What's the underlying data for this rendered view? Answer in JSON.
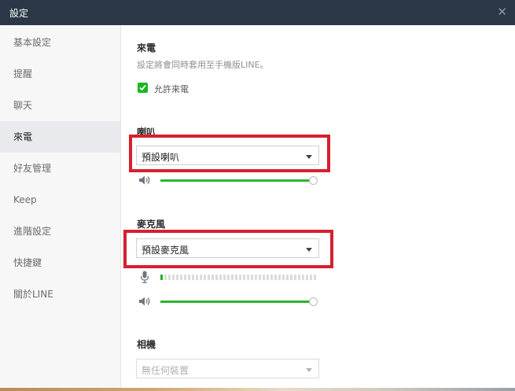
{
  "window": {
    "title": "設定"
  },
  "sidebar": {
    "items": [
      {
        "label": "基本設定"
      },
      {
        "label": "提醒"
      },
      {
        "label": "聊天"
      },
      {
        "label": "來電"
      },
      {
        "label": "好友管理"
      },
      {
        "label": "Keep"
      },
      {
        "label": "進階設定"
      },
      {
        "label": "快捷鍵"
      },
      {
        "label": "關於LINE"
      }
    ],
    "active_index": 3
  },
  "calls": {
    "heading": "來電",
    "description": "設定將會同時套用至手機版LINE。",
    "allow_calls": {
      "label": "允許來電",
      "checked": true
    }
  },
  "speaker": {
    "heading": "喇叭",
    "selected": "預設喇叭",
    "volume": 1.0
  },
  "microphone": {
    "heading": "麥克風",
    "selected": "預設麥克風",
    "input_level_segments_on": 1,
    "input_level_segments_total": 40,
    "volume": 1.0
  },
  "camera": {
    "heading": "相機",
    "selected": "無任何裝置",
    "disabled": true
  },
  "colors": {
    "titlebar": "#2c3747",
    "accent_green": "#19b71f",
    "highlight_red": "#d5202e"
  }
}
